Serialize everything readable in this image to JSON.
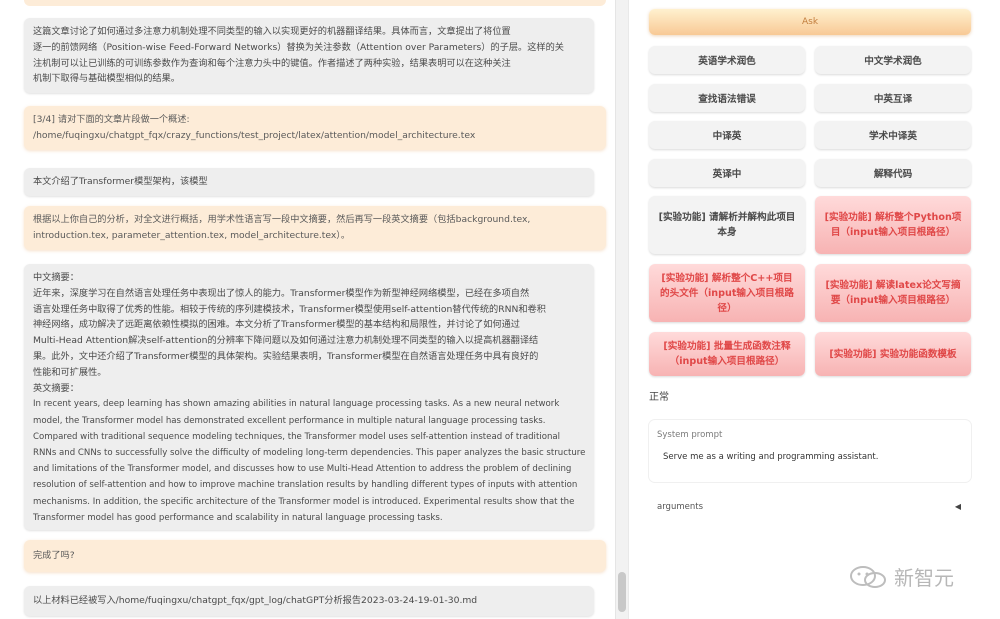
{
  "chat": {
    "messages": [
      {
        "role": "bot",
        "lines": [
          "这篇文章讨论了如何通过多注意力机制处理不同类型的输入以实现更好的机器翻译结果。具体而言，文章提出了将位置",
          "逐一的前馈网络（Position-wise Feed-Forward Networks）替换为关注参数（Attention over Parameters）的子层。这样的关",
          "注机制可以让已训练的可训练参数作为查询和每个注意力头中的键值。作者描述了两种实验，结果表明可以在这种关注",
          "机制下取得与基础模型相似的结果。"
        ]
      },
      {
        "role": "user",
        "lines": [
          "[3/4] 请对下面的文章片段做一个概述:",
          "/home/fuqingxu/chatgpt_fqx/crazy_functions/test_project/latex/attention/model_architecture.tex"
        ]
      },
      {
        "role": "bot",
        "lines": [
          "本文介绍了Transformer模型架构，该模型"
        ]
      },
      {
        "role": "user",
        "lines": [
          "根据以上你自己的分析，对全文进行概括，用学术性语言写一段中文摘要，然后再写一段英文摘要（包括background.tex,",
          "introduction.tex, parameter_attention.tex, model_architecture.tex）。"
        ]
      },
      {
        "role": "bot",
        "lines": [
          "中文摘要：",
          "近年来，深度学习在自然语言处理任务中表现出了惊人的能力。Transformer模型作为新型神经网络模型，已经在多项自然",
          "语言处理任务中取得了优秀的性能。相较于传统的序列建模技术，Transformer模型使用self-attention替代传统的RNN和卷积",
          "神经网络，成功解决了远距离依赖性模拟的困难。本文分析了Transformer模型的基本结构和局限性，并讨论了如何通过",
          "Multi-Head Attention解决self-attention的分辨率下降问题以及如何通过注意力机制处理不同类型的输入以提高机器翻译结",
          "果。此外，文中还介绍了Transformer模型的具体架构。实验结果表明，Transformer模型在自然语言处理任务中具有良好的",
          "性能和可扩展性。",
          "英文摘要："
        ],
        "en_lines": [
          "In recent years, deep learning has shown amazing abilities in natural language processing tasks. As a new neural network",
          "model, the Transformer model has demonstrated excellent performance in multiple natural language processing tasks.",
          "Compared with traditional sequence modeling techniques, the Transformer model uses self-attention instead of traditional",
          "RNNs and CNNs to successfully solve the difficulty of modeling long-term dependencies. This paper analyzes the basic structure",
          "and limitations of the Transformer model, and discusses how to use Multi-Head Attention to address the problem of declining",
          "resolution of self-attention and how to improve machine translation results by handling different types of inputs with attention",
          "mechanisms. In addition, the specific architecture of the Transformer model is introduced. Experimental results show that the",
          "Transformer model has good performance and scalability in natural language processing tasks."
        ]
      },
      {
        "role": "user",
        "lines": [
          "完成了吗?"
        ]
      },
      {
        "role": "bot",
        "lines": [
          "以上材料已经被写入/home/fuqingxu/chatgpt_fqx/gpt_log/chatGPT分析报告2023-03-24-19-01-30.md"
        ]
      }
    ]
  },
  "sidebar": {
    "ask_label": "Ask",
    "buttons": [
      {
        "label": "英语学术润色",
        "style": "normal"
      },
      {
        "label": "中文学术润色",
        "style": "normal"
      },
      {
        "label": "查找语法错误",
        "style": "normal"
      },
      {
        "label": "中英互译",
        "style": "normal"
      },
      {
        "label": "中译英",
        "style": "normal"
      },
      {
        "label": "学术中译英",
        "style": "normal"
      },
      {
        "label": "英译中",
        "style": "normal"
      },
      {
        "label": "解释代码",
        "style": "normal"
      },
      {
        "label": "[实验功能] 请解析并解构此项目本身",
        "style": "normal"
      },
      {
        "label": "[实验功能] 解析整个Python项目（input输入项目根路径）",
        "style": "red"
      },
      {
        "label": "[实验功能] 解析整个C++项目的头文件（input输入项目根路径）",
        "style": "red"
      },
      {
        "label": "[实验功能] 解读latex论文写摘要（input输入项目根路径）",
        "style": "red"
      },
      {
        "label": "[实验功能] 批量生成函数注释（input输入项目根路径）",
        "style": "red"
      },
      {
        "label": "[实验功能] 实验功能函数模板",
        "style": "red"
      }
    ],
    "status": "正常",
    "system_prompt_label": "System prompt",
    "system_prompt_value": "Serve me as a writing and programming assistant.",
    "arguments_label": "arguments",
    "arguments_toggle": "◀"
  },
  "watermark": "新智元",
  "colors": {
    "user_bubble": "#fdecd8",
    "bot_bubble": "#eeeeee",
    "red_button": "#f7b3b3",
    "ask_button": "#f8c995"
  }
}
